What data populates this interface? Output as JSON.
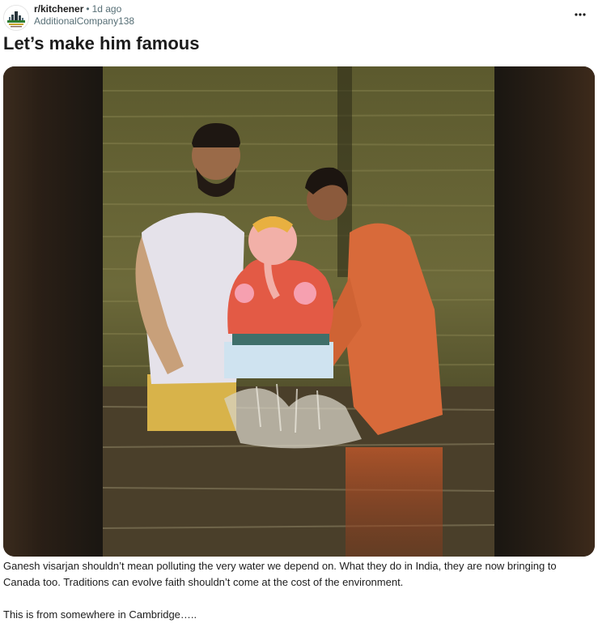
{
  "post": {
    "subreddit": "r/kitchener",
    "separator": "•",
    "time_ago": "1d ago",
    "author": "AdditionalCompany138",
    "title": "Let’s make him famous",
    "more_label": "•••",
    "body_paragraphs": [
      "Ganesh visarjan shouldn’t mean polluting the very water we depend on. What they do in India, they are now bringing to Canada too. Traditions can evolve faith shouldn’t come at the cost of the environment.",
      "This is from somewhere in Cambridge….."
    ]
  },
  "icons": {
    "avatar": "kitchener-skyline-icon",
    "more": "ellipsis-icon"
  },
  "colors": {
    "text_primary": "#1c1c1c",
    "text_secondary": "#576f76",
    "media_background": "#1b1712"
  }
}
